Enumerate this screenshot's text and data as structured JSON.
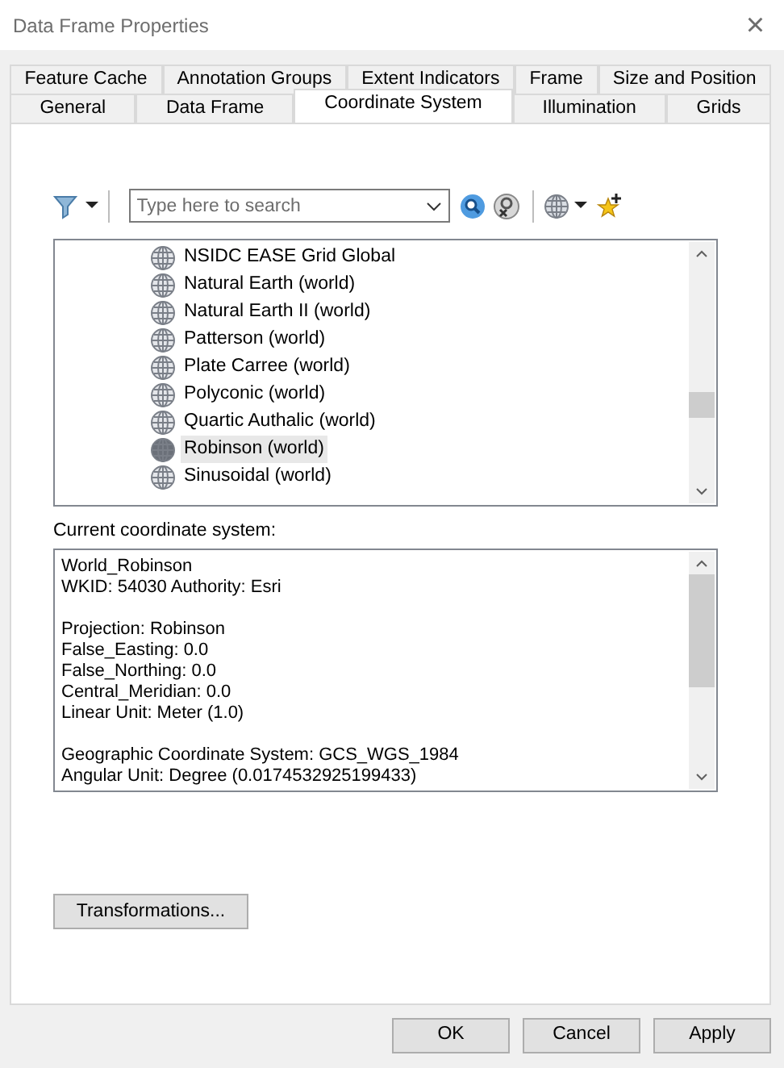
{
  "window": {
    "title": "Data Frame Properties",
    "close": "×"
  },
  "tab_rows": [
    [
      {
        "label": "Feature Cache",
        "selected": false
      },
      {
        "label": "Annotation Groups",
        "selected": false
      },
      {
        "label": "Extent Indicators",
        "selected": false
      },
      {
        "label": "Frame",
        "selected": false
      },
      {
        "label": "Size and Position",
        "selected": false
      }
    ],
    [
      {
        "label": "General",
        "selected": false
      },
      {
        "label": "Data Frame",
        "selected": false
      },
      {
        "label": "Coordinate System",
        "selected": true
      },
      {
        "label": "Illumination",
        "selected": false
      },
      {
        "label": "Grids",
        "selected": false
      }
    ]
  ],
  "search": {
    "placeholder": "Type here to search"
  },
  "coordinate_list": [
    {
      "label": "NSIDC EASE Grid Global",
      "selected": false
    },
    {
      "label": "Natural Earth (world)",
      "selected": false
    },
    {
      "label": "Natural Earth II (world)",
      "selected": false
    },
    {
      "label": "Patterson (world)",
      "selected": false
    },
    {
      "label": "Plate Carree (world)",
      "selected": false
    },
    {
      "label": "Polyconic (world)",
      "selected": false
    },
    {
      "label": "Quartic Authalic (world)",
      "selected": false
    },
    {
      "label": "Robinson (world)",
      "selected": true
    },
    {
      "label": "Sinusoidal (world)",
      "selected": false
    }
  ],
  "current_label": "Current coordinate system:",
  "current_details": [
    [
      "World_Robinson",
      "WKID: 54030 Authority: Esri"
    ],
    [
      "Projection: Robinson",
      "False_Easting: 0.0",
      "False_Northing: 0.0",
      "Central_Meridian: 0.0",
      "Linear Unit: Meter (1.0)"
    ],
    [
      "Geographic Coordinate System: GCS_WGS_1984",
      "Angular Unit: Degree (0.0174532925199433)"
    ]
  ],
  "transformations_button": "Transformations...",
  "buttons": [
    "OK",
    "Cancel",
    "Apply"
  ]
}
